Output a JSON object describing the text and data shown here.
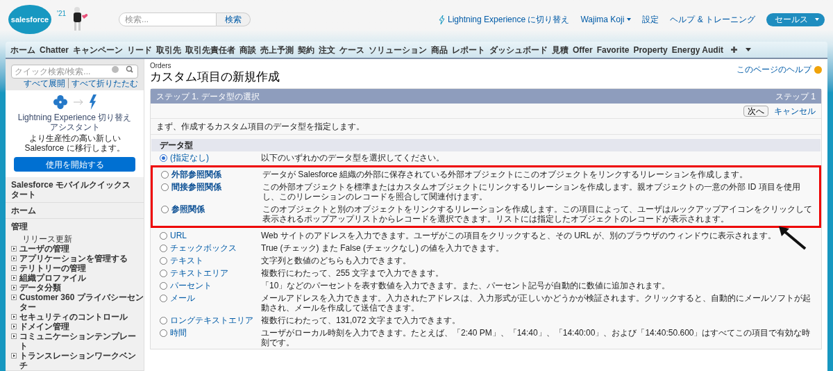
{
  "header": {
    "logo": "salesforce",
    "year": "'21",
    "search": {
      "placeholder": "検索...",
      "button": "検索"
    },
    "lightning_link": "Lightning Experience に切り替え",
    "user_menu": "Wajima Koji",
    "setup_link": "設定",
    "help_link": "ヘルプ & トレーニング",
    "app_menu": "セールス"
  },
  "tabs": [
    {
      "label": "ホーム",
      "selected": false
    },
    {
      "label": "Chatter",
      "selected": false
    },
    {
      "label": "キャンペーン",
      "selected": false
    },
    {
      "label": "リード",
      "selected": false
    },
    {
      "label": "取引先",
      "selected": false
    },
    {
      "label": "取引先責任者",
      "selected": false
    },
    {
      "label": "商談",
      "selected": false
    },
    {
      "label": "売上予測",
      "selected": false
    },
    {
      "label": "契約",
      "selected": false
    },
    {
      "label": "注文",
      "selected": false
    },
    {
      "label": "ケース",
      "selected": false
    },
    {
      "label": "ソリューション",
      "selected": false
    },
    {
      "label": "商品",
      "selected": false
    },
    {
      "label": "レポート",
      "selected": false
    },
    {
      "label": "ダッシュボード",
      "selected": false
    },
    {
      "label": "見積",
      "selected": false
    },
    {
      "label": "Offer",
      "selected": false
    },
    {
      "label": "Favorite",
      "selected": false
    },
    {
      "label": "Property",
      "selected": false
    },
    {
      "label": "Energy Audit",
      "selected": false
    }
  ],
  "sidebar": {
    "quick_search": {
      "placeholder": "クイック検索/検索..."
    },
    "expand_all": "すべて展開",
    "collapse_all": "すべて折りたたむ",
    "promo": {
      "title": "Lightning Experience 切り替えアシスタント",
      "text": "より生産性の高い新しい Salesforce に移行します。",
      "button": "使用を開始する"
    },
    "sections": [
      {
        "title": "Salesforce モバイルクイックスタート"
      },
      {
        "title": "ホーム"
      },
      {
        "title": "管理",
        "items": [
          {
            "label": "リリース更新",
            "kind": "plain"
          },
          {
            "label": "ユーザの管理",
            "kind": "expandable"
          },
          {
            "label": "アプリケーションを管理する",
            "kind": "expandable"
          },
          {
            "label": "テリトリーの管理",
            "kind": "expandable"
          },
          {
            "label": "組織プロファイル",
            "kind": "expandable"
          },
          {
            "label": "データ分類",
            "kind": "expandable"
          },
          {
            "label": "Customer 360 プライバシーセンター",
            "kind": "expandable"
          },
          {
            "label": "セキュリティのコントロール",
            "kind": "expandable"
          },
          {
            "label": "ドメイン管理",
            "kind": "expandable"
          },
          {
            "label": "コミュニケーションテンプレート",
            "kind": "expandable"
          },
          {
            "label": "トランスレーションワークベンチ",
            "kind": "expandable"
          }
        ]
      }
    ]
  },
  "main": {
    "object": "Orders",
    "title": "カスタム項目の新規作成",
    "help_link": "このページのヘルプ",
    "step_title": "ステップ 1. データ型の選択",
    "step_number": "ステップ 1",
    "buttons": {
      "next": "次へ",
      "cancel": "キャンセル"
    },
    "intro": "まず、作成するカスタム項目のデータ型を指定します。",
    "section": "データ型",
    "options": [
      {
        "label": "(指定なし)",
        "description": "以下のいずれかのデータ型を選択してください。",
        "selected": true,
        "highlighted": false
      },
      {
        "label": "外部参照関係",
        "description": "データが Salesforce 組織の外部に保存されている外部オブジェクトにこのオブジェクトをリンクするリレーションを作成します。",
        "selected": false,
        "highlighted": true
      },
      {
        "label": "間接参照関係",
        "description": "この外部オブジェクトを標準またはカスタムオブジェクトにリンクするリレーションを作成します。親オブジェクトの一意の外部 ID 項目を使用し、このリレーションのレコードを照合して関連付けます。",
        "selected": false,
        "highlighted": true
      },
      {
        "label": "参照関係",
        "description": "このオブジェクトと別のオブジェクトをリンクするリレーションを作成します。この項目によって、ユーザはルックアップアイコンをクリックして表示されるポップアップリストからレコードを選択できます。リストには指定したオブジェクトのレコードが表示されます。",
        "selected": false,
        "highlighted": true
      },
      {
        "label": "URL",
        "description": "Web サイトのアドレスを入力できます。ユーザがこの項目をクリックすると、その URL が、別のブラウザのウィンドウに表示されます。",
        "selected": false,
        "highlighted": false
      },
      {
        "label": "チェックボックス",
        "description": "True (チェック) また False (チェックなし) の値を入力できます。",
        "selected": false,
        "highlighted": false
      },
      {
        "label": "テキスト",
        "description": "文字列と数値のどちらも入力できます。",
        "selected": false,
        "highlighted": false
      },
      {
        "label": "テキストエリア",
        "description": "複数行にわたって、255 文字まで入力できます。",
        "selected": false,
        "highlighted": false
      },
      {
        "label": "パーセント",
        "description": "「10」などのパーセントを表す数値を入力できます。また、パーセント記号が自動的に数値に追加されます。",
        "selected": false,
        "highlighted": false
      },
      {
        "label": "メール",
        "description": "メールアドレスを入力できます。入力されたアドレスは、入力形式が正しいかどうかが検証されます。クリックすると、自動的にメールソフトが起動され、メールを作成して送信できます。",
        "selected": false,
        "highlighted": false
      },
      {
        "label": "ロングテキストエリア",
        "description": "複数行にわたって、131,072 文字まで入力できます。",
        "selected": false,
        "highlighted": false
      },
      {
        "label": "時間",
        "description": "ユーザがローカル時刻を入力できます。たとえば、「2:40 PM」、「14:40」、「14:40:00」、および「14:40:50.600」はすべてこの項目で有効な時刻です。",
        "selected": false,
        "highlighted": false
      }
    ]
  }
}
